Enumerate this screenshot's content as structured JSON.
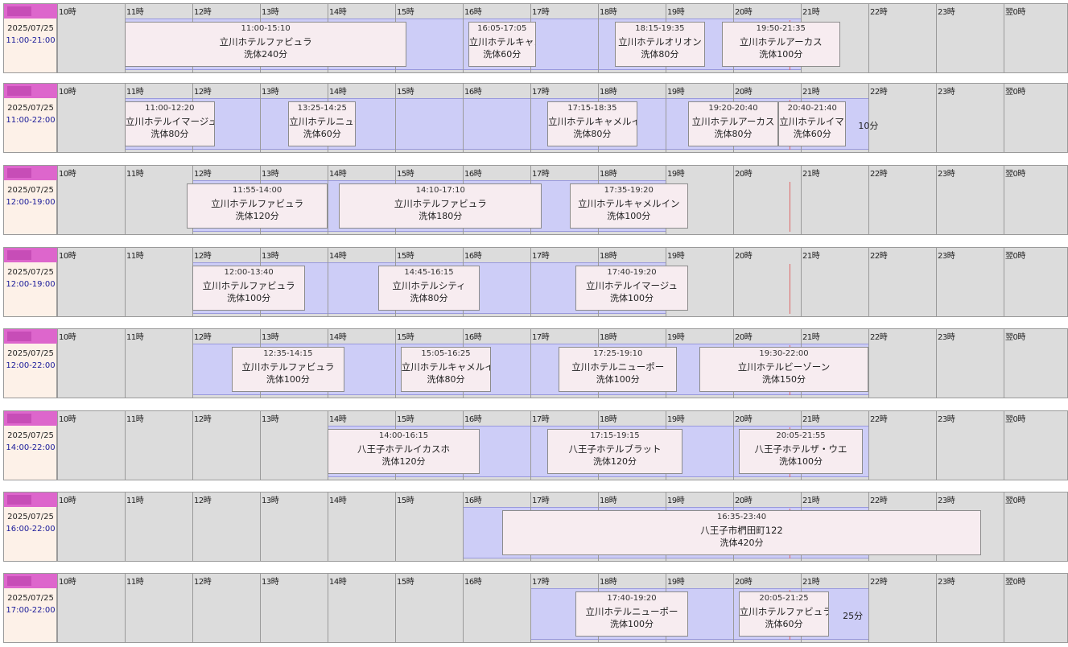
{
  "hour_labels": [
    "10時",
    "11時",
    "12時",
    "13時",
    "14時",
    "15時",
    "16時",
    "17時",
    "18時",
    "19時",
    "20時",
    "21時",
    "22時",
    "23時",
    "翌0時"
  ],
  "rows": [
    {
      "date": "2025/07/25",
      "hours": "11:00-21:00",
      "shift": [
        11.0,
        21.0
      ],
      "marker": 20.83,
      "jobs": [
        {
          "time": "11:00-15:10",
          "name": "立川ホテルファビュラ",
          "dur": "洗体240分",
          "s": 11.0,
          "e": 15.17
        },
        {
          "time": "16:05-17:05",
          "name": "立川ホテルキャメルイン",
          "dur": "洗体60分",
          "s": 16.08,
          "e": 17.08
        },
        {
          "time": "18:15-19:35",
          "name": "立川ホテルオリオン",
          "dur": "洗体80分",
          "s": 18.25,
          "e": 19.58
        },
        {
          "time": "19:50-21:35",
          "name": "立川ホテルアーカス",
          "dur": "洗体100分",
          "s": 19.83,
          "e": 21.58
        }
      ],
      "trail": ""
    },
    {
      "date": "2025/07/25",
      "hours": "11:00-22:00",
      "shift": [
        11.0,
        22.0
      ],
      "marker": 20.83,
      "jobs": [
        {
          "time": "11:00-12:20",
          "name": "立川ホテルイマージュ",
          "dur": "洗体80分",
          "s": 11.0,
          "e": 12.33
        },
        {
          "time": "13:25-14:25",
          "name": "立川ホテルニューポー",
          "dur": "洗体60分",
          "s": 13.42,
          "e": 14.42
        },
        {
          "time": "17:15-18:35",
          "name": "立川ホテルキャメルイン",
          "dur": "洗体80分",
          "s": 17.25,
          "e": 18.58
        },
        {
          "time": "19:20-20:40",
          "name": "立川ホテルアーカス",
          "dur": "洗体80分",
          "s": 19.33,
          "e": 20.67
        },
        {
          "time": "20:40-21:40",
          "name": "立川ホテルイマージュ",
          "dur": "洗体60分",
          "s": 20.67,
          "e": 21.67
        }
      ],
      "trail": "10分",
      "trail_at": 21.85
    },
    {
      "date": "2025/07/25",
      "hours": "12:00-19:00",
      "shift": [
        12.0,
        19.0
      ],
      "marker": 20.83,
      "jobs": [
        {
          "time": "11:55-14:00",
          "name": "立川ホテルファビュラ",
          "dur": "洗体120分",
          "s": 11.92,
          "e": 14.0
        },
        {
          "time": "14:10-17:10",
          "name": "立川ホテルファビュラ",
          "dur": "洗体180分",
          "s": 14.17,
          "e": 17.17
        },
        {
          "time": "17:35-19:20",
          "name": "立川ホテルキャメルイン",
          "dur": "洗体100分",
          "s": 17.58,
          "e": 19.33
        }
      ],
      "trail": ""
    },
    {
      "date": "2025/07/25",
      "hours": "12:00-19:00",
      "shift": [
        12.0,
        19.0
      ],
      "marker": 20.83,
      "jobs": [
        {
          "time": "12:00-13:40",
          "name": "立川ホテルファビュラ",
          "dur": "洗体100分",
          "s": 12.0,
          "e": 13.67
        },
        {
          "time": "14:45-16:15",
          "name": "立川ホテルシティ",
          "dur": "洗体80分",
          "s": 14.75,
          "e": 16.25
        },
        {
          "time": "17:40-19:20",
          "name": "立川ホテルイマージュ",
          "dur": "洗体100分",
          "s": 17.67,
          "e": 19.33
        }
      ],
      "trail": ""
    },
    {
      "date": "2025/07/25",
      "hours": "12:00-22:00",
      "shift": [
        12.0,
        22.0
      ],
      "marker": 20.83,
      "jobs": [
        {
          "time": "12:35-14:15",
          "name": "立川ホテルファビュラ",
          "dur": "洗体100分",
          "s": 12.58,
          "e": 14.25
        },
        {
          "time": "15:05-16:25",
          "name": "立川ホテルキャメルイン",
          "dur": "洗体80分",
          "s": 15.08,
          "e": 16.42
        },
        {
          "time": "17:25-19:10",
          "name": "立川ホテルニューポー",
          "dur": "洗体100分",
          "s": 17.42,
          "e": 19.17
        },
        {
          "time": "19:30-22:00",
          "name": "立川ホテルビーゾーン",
          "dur": "洗体150分",
          "s": 19.5,
          "e": 22.0
        }
      ],
      "trail": ""
    },
    {
      "date": "2025/07/25",
      "hours": "14:00-22:00",
      "shift": [
        14.0,
        22.0
      ],
      "marker": 20.83,
      "jobs": [
        {
          "time": "14:00-16:15",
          "name": "八王子ホテルイカスホ",
          "dur": "洗体120分",
          "s": 14.0,
          "e": 16.25
        },
        {
          "time": "17:15-19:15",
          "name": "八王子ホテルブラット",
          "dur": "洗体120分",
          "s": 17.25,
          "e": 19.25
        },
        {
          "time": "20:05-21:55",
          "name": "八王子ホテルザ・ウエ",
          "dur": "洗体100分",
          "s": 20.08,
          "e": 21.92
        }
      ],
      "trail": ""
    },
    {
      "date": "2025/07/25",
      "hours": "16:00-22:00",
      "shift": [
        16.0,
        22.0
      ],
      "marker": 20.83,
      "jobs": [
        {
          "time": "16:35-23:40",
          "name": "八王子市椚田町122",
          "dur": "洗体420分",
          "s": 16.58,
          "e": 23.67
        }
      ],
      "trail": ""
    },
    {
      "date": "2025/07/25",
      "hours": "17:00-22:00",
      "shift": [
        17.0,
        22.0
      ],
      "marker": 20.83,
      "jobs": [
        {
          "time": "17:40-19:20",
          "name": "立川ホテルニューポー",
          "dur": "洗体100分",
          "s": 17.67,
          "e": 19.33
        },
        {
          "time": "20:05-21:25",
          "name": "立川ホテルファビュラ",
          "dur": "洗体60分",
          "s": 20.08,
          "e": 21.42
        }
      ],
      "trail": "25分",
      "trail_at": 21.62
    }
  ]
}
